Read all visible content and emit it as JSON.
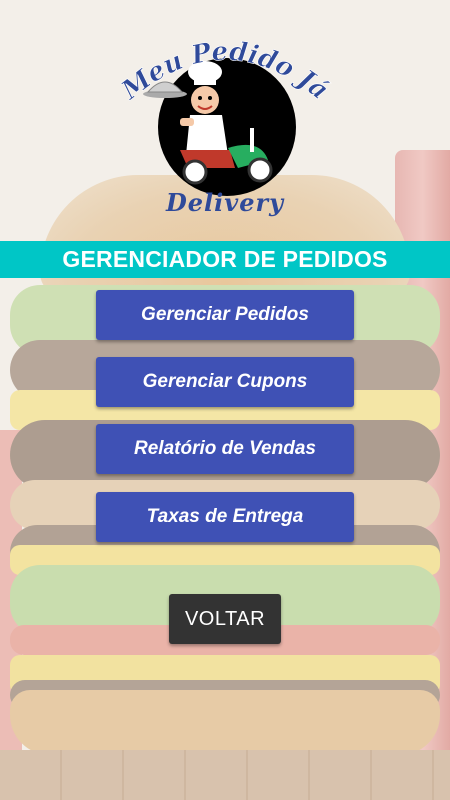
{
  "logo": {
    "title": "Meu Pedido Já",
    "subtitle": "Delivery",
    "icon": "chef-scooter-icon"
  },
  "header": {
    "title": "GERENCIADOR DE PEDIDOS",
    "color": "#00c6c6"
  },
  "menu": {
    "buttons": [
      {
        "label": "Gerenciar Pedidos"
      },
      {
        "label": "Gerenciar Cupons"
      },
      {
        "label": "Relatório de Vendas"
      },
      {
        "label": "Taxas de Entrega"
      }
    ],
    "button_color": "#3f51b5"
  },
  "back_button": {
    "label": "VOLTAR",
    "color": "#333333"
  },
  "background": {
    "image": "burger-background"
  }
}
